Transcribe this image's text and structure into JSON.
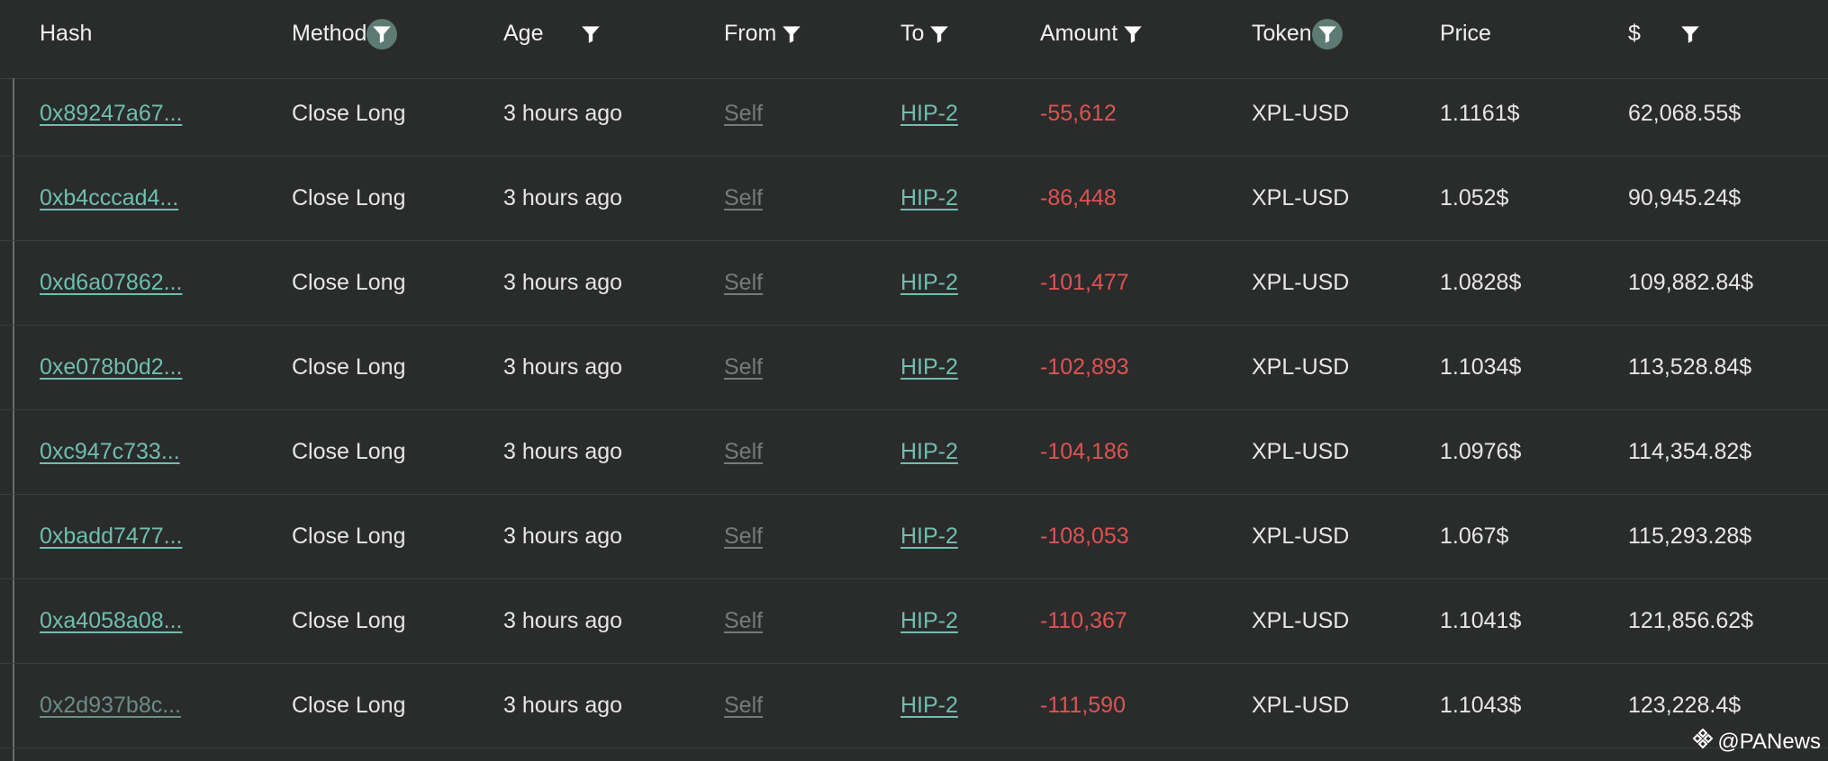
{
  "columns": [
    {
      "key": "hash",
      "label": "Hash",
      "filter": "none"
    },
    {
      "key": "method",
      "label": "Method",
      "filter": "active"
    },
    {
      "key": "age",
      "label": "Age",
      "filter": "plain"
    },
    {
      "key": "from",
      "label": "From",
      "filter": "plain"
    },
    {
      "key": "to",
      "label": "To",
      "filter": "plain"
    },
    {
      "key": "amount",
      "label": "Amount",
      "filter": "plain"
    },
    {
      "key": "token",
      "label": "Token",
      "filter": "active"
    },
    {
      "key": "price",
      "label": "Price",
      "filter": "none"
    },
    {
      "key": "usd",
      "label": "$",
      "filter": "plain"
    }
  ],
  "rows": [
    {
      "hash": "0x89247a67...",
      "method": "Close Long",
      "age": "3 hours ago",
      "from": "Self",
      "to": "HIP-2",
      "amount": "-55,612",
      "token": "XPL-USD",
      "price": "1.1161$",
      "usd": "62,068.55$"
    },
    {
      "hash": "0xb4cccad4...",
      "method": "Close Long",
      "age": "3 hours ago",
      "from": "Self",
      "to": "HIP-2",
      "amount": "-86,448",
      "token": "XPL-USD",
      "price": "1.052$",
      "usd": "90,945.24$"
    },
    {
      "hash": "0xd6a07862...",
      "method": "Close Long",
      "age": "3 hours ago",
      "from": "Self",
      "to": "HIP-2",
      "amount": "-101,477",
      "token": "XPL-USD",
      "price": "1.0828$",
      "usd": "109,882.84$"
    },
    {
      "hash": "0xe078b0d2...",
      "method": "Close Long",
      "age": "3 hours ago",
      "from": "Self",
      "to": "HIP-2",
      "amount": "-102,893",
      "token": "XPL-USD",
      "price": "1.1034$",
      "usd": "113,528.84$"
    },
    {
      "hash": "0xc947c733...",
      "method": "Close Long",
      "age": "3 hours ago",
      "from": "Self",
      "to": "HIP-2",
      "amount": "-104,186",
      "token": "XPL-USD",
      "price": "1.0976$",
      "usd": "114,354.82$"
    },
    {
      "hash": "0xbadd7477...",
      "method": "Close Long",
      "age": "3 hours ago",
      "from": "Self",
      "to": "HIP-2",
      "amount": "-108,053",
      "token": "XPL-USD",
      "price": "1.067$",
      "usd": "115,293.28$"
    },
    {
      "hash": "0xa4058a08...",
      "method": "Close Long",
      "age": "3 hours ago",
      "from": "Self",
      "to": "HIP-2",
      "amount": "-110,367",
      "token": "XPL-USD",
      "price": "1.1041$",
      "usd": "121,856.62$"
    },
    {
      "hash": "0x2d937b8c...",
      "method": "Close Long",
      "age": "3 hours ago",
      "from": "Self",
      "to": "HIP-2",
      "amount": "-111,590",
      "token": "XPL-USD",
      "price": "1.1043$",
      "usd": "123,228.4$"
    }
  ],
  "watermark": {
    "text": "@PANews",
    "icon": "panews-logo-icon"
  },
  "colors": {
    "background": "#2a2b2b",
    "link": "#6fbfae",
    "negative": "#e05252",
    "self_link": "#787a7a",
    "filter_active_bg": "#5d7b73"
  }
}
